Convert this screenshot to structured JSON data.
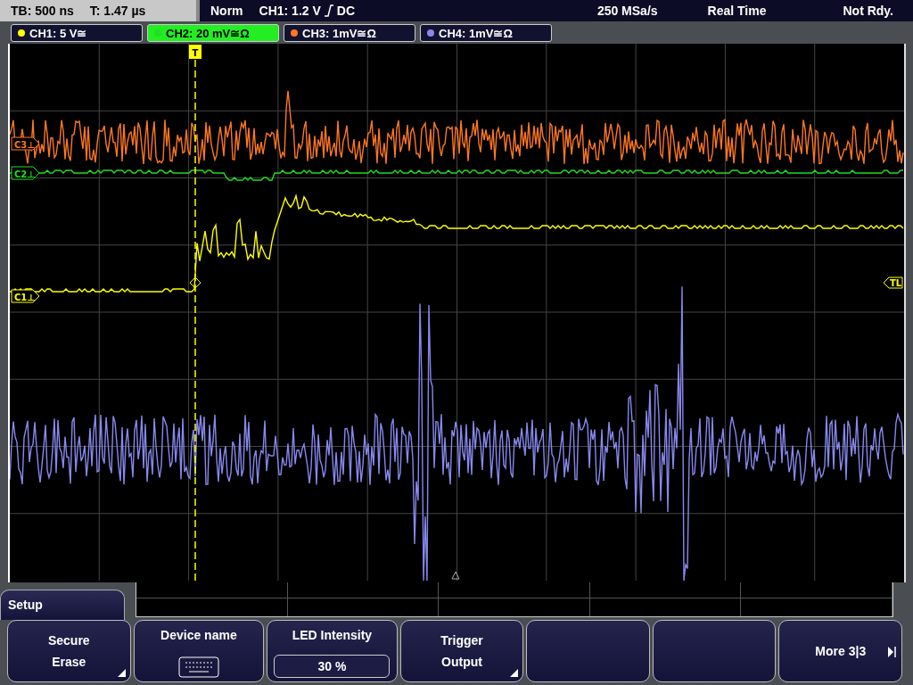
{
  "status_bar": {
    "timebase": "TB: 500 ns",
    "trigger_time": "T: 1.47 µs",
    "mode": "Norm",
    "trigger_level": "CH1: 1.2 V",
    "coupling": "DC",
    "sample_rate": "250 MSa/s",
    "acquisition": "Real Time",
    "status": "Not Rdy."
  },
  "channels": [
    {
      "label": "CH1: 5 V≅",
      "color": "#ffff00",
      "selected": false
    },
    {
      "label": "CH2: 20 mV≅Ω",
      "color": "#22dd22",
      "selected": true
    },
    {
      "label": "CH3: 1mV≅Ω",
      "color": "#ff7722",
      "selected": false
    },
    {
      "label": "CH4: 1mV≅Ω",
      "color": "#8888ee",
      "selected": false
    }
  ],
  "markers": [
    {
      "label": "C3⊥",
      "color": "#ff7722"
    },
    {
      "label": "C2⊥",
      "color": "#22dd22"
    },
    {
      "label": "C1⊥",
      "color": "#ffff00"
    }
  ],
  "trigger_marker": "T",
  "trigger_level_marker": "TL",
  "menu": {
    "title": "Setup",
    "softkeys": [
      {
        "kind": "menu",
        "lines": [
          "Secure",
          "Erase"
        ]
      },
      {
        "kind": "icon",
        "label": "Device name"
      },
      {
        "kind": "value",
        "label": "LED Intensity",
        "value": "30 %"
      },
      {
        "kind": "menu",
        "lines": [
          "Trigger",
          "Output"
        ]
      },
      {
        "kind": "empty"
      },
      {
        "kind": "empty"
      },
      {
        "kind": "next",
        "label": "More 3|3"
      }
    ]
  }
}
